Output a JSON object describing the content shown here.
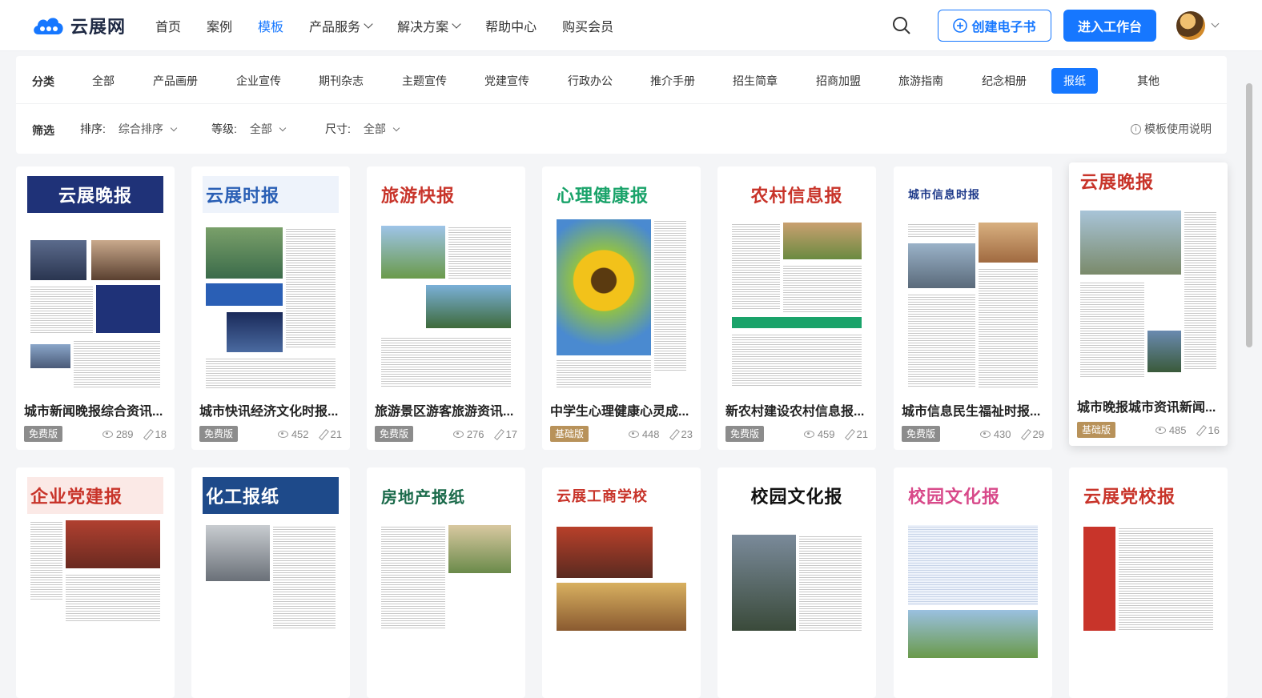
{
  "brand": {
    "name": "云展网",
    "accent": "#1677ff"
  },
  "nav": {
    "items": [
      "首页",
      "案例",
      "模板",
      "产品服务",
      "解决方案",
      "帮助中心",
      "购买会员"
    ],
    "active": "模板"
  },
  "header": {
    "create_label": "创建电子书",
    "enter_label": "进入工作台"
  },
  "category": {
    "label": "分类",
    "items": [
      "全部",
      "产品画册",
      "企业宣传",
      "期刊杂志",
      "主题宣传",
      "党建宣传",
      "行政办公",
      "推介手册",
      "招生简章",
      "招商加盟",
      "旅游指南",
      "纪念相册",
      "报纸",
      "其他"
    ],
    "active": "报纸"
  },
  "filter": {
    "label": "筛选",
    "sort_label": "排序:",
    "sort_value": "综合排序",
    "level_label": "等级:",
    "level_value": "全部",
    "size_label": "尺寸:",
    "size_value": "全部",
    "help": "模板使用说明"
  },
  "cards": [
    {
      "masthead": "云展晚报",
      "title": "城市新闻晚报综合资讯...",
      "badge": "免费版",
      "views": "289",
      "edits": "18"
    },
    {
      "masthead": "云展时报",
      "title": "城市快讯经济文化时报...",
      "badge": "免费版",
      "views": "452",
      "edits": "21"
    },
    {
      "masthead": "旅游快报",
      "title": "旅游景区游客旅游资讯...",
      "badge": "免费版",
      "views": "276",
      "edits": "17"
    },
    {
      "masthead": "心理健康报",
      "title": "中学生心理健康心灵成...",
      "badge": "基础版",
      "views": "448",
      "edits": "23"
    },
    {
      "masthead": "农村信息报",
      "title": "新农村建设农村信息报...",
      "badge": "免费版",
      "views": "459",
      "edits": "21"
    },
    {
      "masthead": "城市信息时报",
      "title": "城市信息民生福祉时报...",
      "badge": "免费版",
      "views": "430",
      "edits": "29"
    },
    {
      "masthead": "云展晚报",
      "title": "城市晚报城市资讯新闻...",
      "badge": "基础版",
      "views": "485",
      "edits": "16"
    }
  ],
  "cards2": [
    {
      "masthead": "企业党建报"
    },
    {
      "masthead": "化工报纸"
    },
    {
      "masthead": "房地产报纸"
    },
    {
      "masthead": "云展工商学校"
    },
    {
      "masthead": "校园文化报"
    },
    {
      "masthead": "校园文化报"
    },
    {
      "masthead": "云展党校报"
    }
  ]
}
